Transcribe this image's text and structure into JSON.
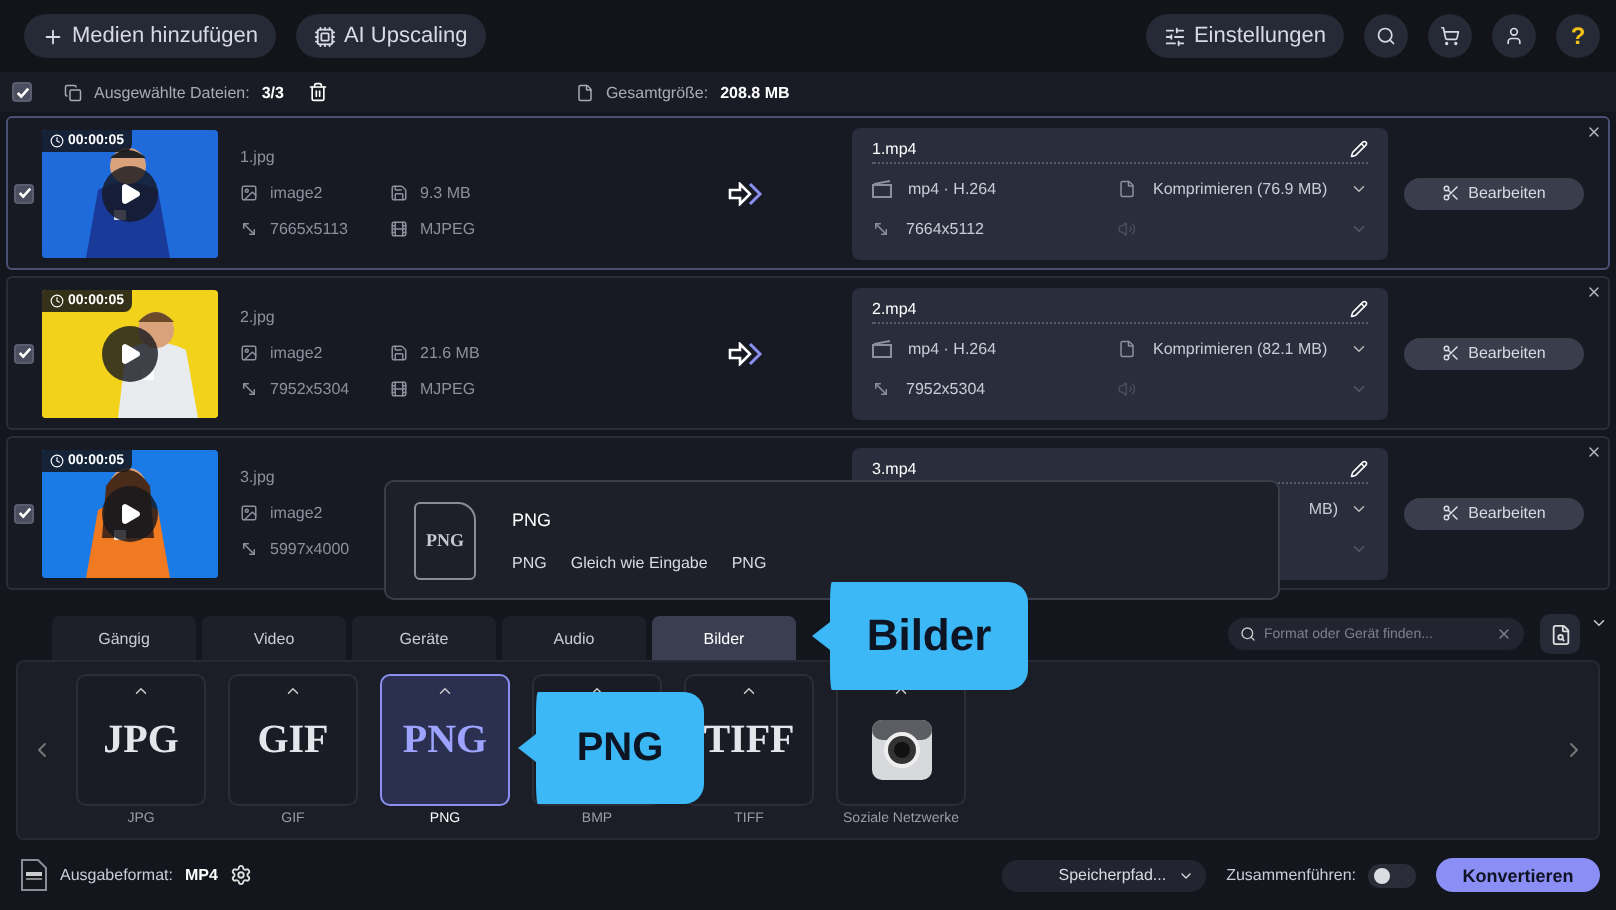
{
  "toolbar": {
    "buttons": [
      {
        "label": "Medien hinzufügen",
        "kind": "add"
      },
      {
        "label": "AI Upscaling",
        "kind": "ai"
      }
    ],
    "settings": "Einstellungen",
    "help": "?"
  },
  "selection": {
    "checked": true,
    "label": "Ausgewählte Dateien:",
    "count": "3/3",
    "total_label": "Gesamtgröße:",
    "total": "208.8 MB"
  },
  "files": [
    {
      "checked": true,
      "duration": "00:00:05",
      "name": "1.jpg",
      "codec_in": "image2",
      "size_in": "9.3 MB",
      "resolution_in": "7665x5113",
      "format_in": "MJPEG",
      "output_name": "1.mp4",
      "output_format": "mp4 · H.264",
      "compress": "Komprimieren (76.9 MB)",
      "output_resolution": "7664x5112",
      "edit": "Bearbeiten"
    },
    {
      "checked": true,
      "duration": "00:00:05",
      "name": "2.jpg",
      "codec_in": "image2",
      "size_in": "21.6 MB",
      "resolution_in": "7952x5304",
      "format_in": "MJPEG",
      "output_name": "2.mp4",
      "output_format": "mp4 · H.264",
      "compress": "Komprimieren (82.1 MB)",
      "output_resolution": "7952x5304",
      "edit": "Bearbeiten"
    },
    {
      "checked": true,
      "duration": "00:00:05",
      "name": "3.jpg",
      "codec_in": "image2",
      "resolution_in": "5997x4000",
      "output_name": "3.mp4",
      "compress": "MB)",
      "edit": "Bearbeiten"
    }
  ],
  "popup": {
    "icon_label": "PNG",
    "title": "PNG",
    "details": [
      "PNG",
      "Gleich wie Eingabe",
      "PNG"
    ]
  },
  "tabs": [
    {
      "label": "Gängig",
      "selected": false
    },
    {
      "label": "Video",
      "selected": false
    },
    {
      "label": "Geräte",
      "selected": false
    },
    {
      "label": "Audio",
      "selected": false
    },
    {
      "label": "Bilder",
      "selected": true
    }
  ],
  "search": {
    "placeholder": "Format oder Gerät finden..."
  },
  "formats": [
    {
      "kind": "logo",
      "logo": "JPG",
      "label": "JPG",
      "selected": false
    },
    {
      "kind": "logo",
      "logo": "GIF",
      "label": "GIF",
      "selected": false
    },
    {
      "kind": "logo",
      "logo": "PNG",
      "label": "PNG",
      "selected": true
    },
    {
      "kind": "hidden",
      "label": "BMP",
      "selected": false
    },
    {
      "kind": "logo",
      "logo": "TIFF",
      "label": "TIFF",
      "selected": false
    },
    {
      "kind": "camera",
      "label": "Soziale Netzwerke",
      "selected": false
    }
  ],
  "callouts": [
    {
      "text": "Bilder"
    },
    {
      "text": "PNG"
    }
  ],
  "bottom": {
    "output_label": "Ausgabeformat:",
    "output_value": "MP4",
    "save_path": "Speicherpfad...",
    "merge_label": "Zusammenführen:",
    "merge_on": false,
    "convert": "Konvertieren"
  }
}
